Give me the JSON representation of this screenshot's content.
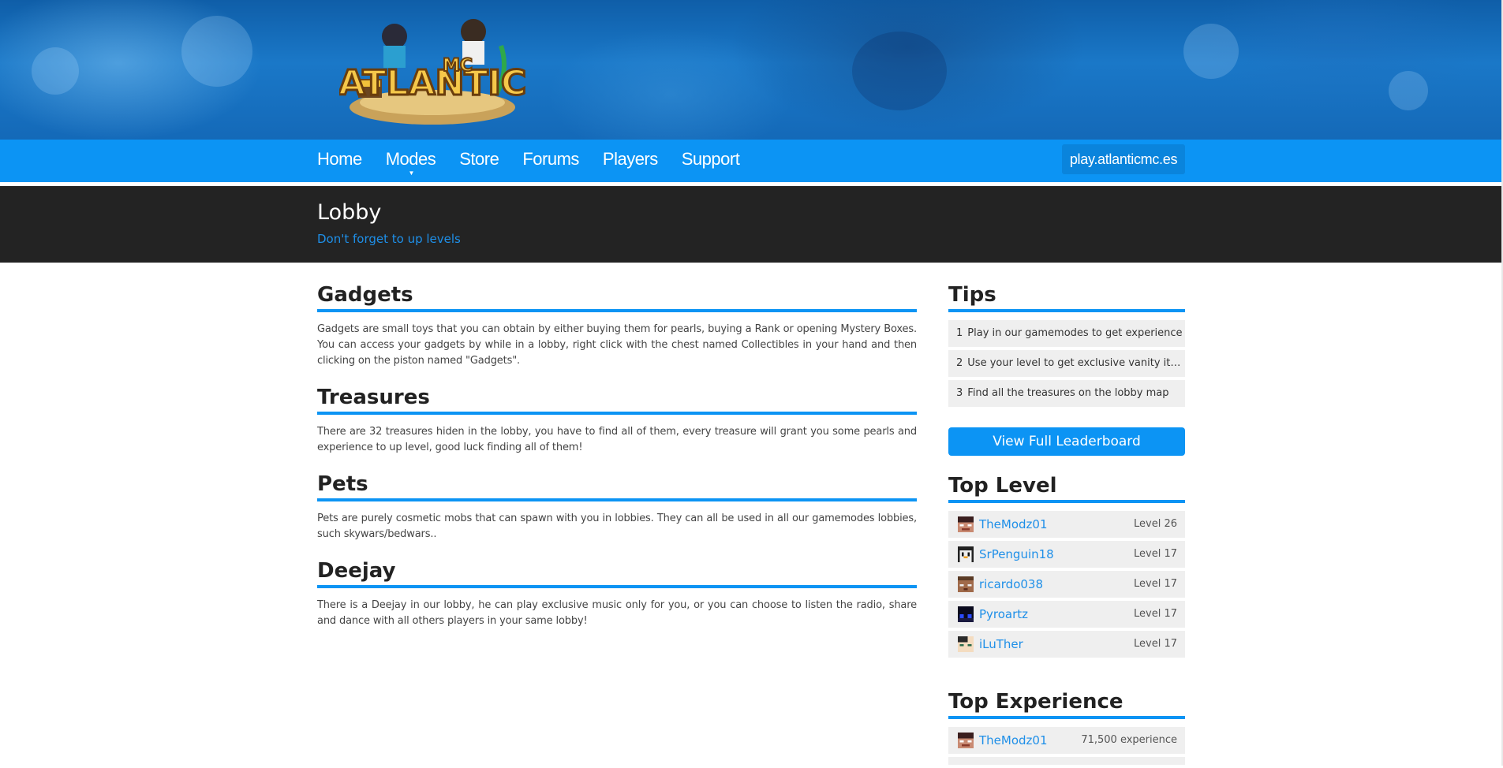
{
  "nav": {
    "items": [
      "Home",
      "Modes",
      "Store",
      "Forums",
      "Players",
      "Support"
    ],
    "server_ip": "play.atlanticmc.es"
  },
  "logo_text": "ATLANTIC MC",
  "title_bar": {
    "title": "Lobby",
    "subtitle": "Don't forget to up levels"
  },
  "sections": [
    {
      "heading": "Gadgets",
      "body": "Gadgets are small toys that you can obtain by either buying them for pearls, buying a Rank or opening Mystery Boxes. You can access your gadgets by while in a lobby, right click with the chest named Collectibles in your hand and then clicking on the piston named \"Gadgets\"."
    },
    {
      "heading": "Treasures",
      "body": "There are 32 treasures hiden in the lobby, you have to find all of them, every treasure will grant you some pearls and experience to up level, good luck finding all of them!"
    },
    {
      "heading": "Pets",
      "body": "Pets are purely cosmetic mobs that can spawn with you in lobbies. They can all be used in all our gamemodes lobbies, such skywars/bedwars.."
    },
    {
      "heading": "Deejay",
      "body": "There is a Deejay in our lobby, he can play exclusive music only for you, or you can choose to listen the radio, share and dance with all others players in your same lobby!"
    }
  ],
  "sidebar": {
    "tips_heading": "Tips",
    "tips": [
      {
        "num": "1",
        "text": "Play in our gamemodes to get experience"
      },
      {
        "num": "2",
        "text": "Use your level to get exclusive vanity items"
      },
      {
        "num": "3",
        "text": "Find all the treasures on the lobby map"
      }
    ],
    "leaderboard_button": "View Full Leaderboard",
    "top_level_heading": "Top Level",
    "top_level": [
      {
        "name": "TheModz01",
        "value": "Level 26"
      },
      {
        "name": "SrPenguin18",
        "value": "Level 17"
      },
      {
        "name": "ricardo038",
        "value": "Level 17"
      },
      {
        "name": "Pyroartz",
        "value": "Level 17"
      },
      {
        "name": "iLuTher",
        "value": "Level 17"
      }
    ],
    "top_exp_heading": "Top Experience",
    "top_experience": [
      {
        "name": "TheModz01",
        "value": "71,500 experience"
      }
    ]
  },
  "colors": {
    "accent": "#0c94f4",
    "title_bar_bg": "#232323",
    "link": "#1e8fe8"
  }
}
